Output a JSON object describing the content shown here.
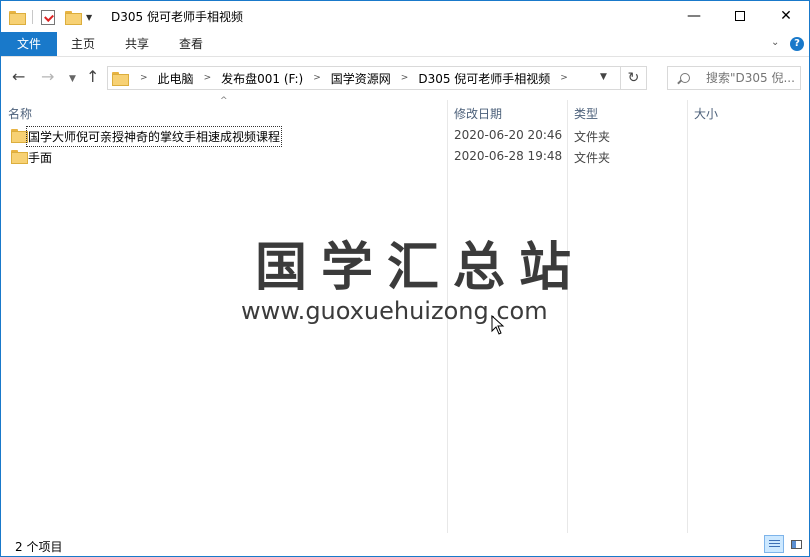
{
  "window": {
    "title": "D305 倪可老师手相视频",
    "accent_color": "#1979ca",
    "controls": {
      "minimize": "—",
      "maximize": "maximize",
      "close": "✕"
    }
  },
  "ribbon": {
    "tabs": [
      {
        "label": "文件",
        "active": true
      },
      {
        "label": "主页"
      },
      {
        "label": "共享"
      },
      {
        "label": "查看"
      }
    ],
    "help": "?"
  },
  "navigation": {
    "back": "←",
    "forward": "→",
    "recent": "⌄",
    "up": "↑",
    "breadcrumbs": [
      "此电脑",
      "发布盘001 (F:)",
      "国学资源网",
      "D305 倪可老师手相视频"
    ],
    "refresh": "↻",
    "search_placeholder": "搜索\"D305 倪..."
  },
  "columns": {
    "name": "名称",
    "date": "修改日期",
    "type": "类型",
    "size": "大小"
  },
  "files": [
    {
      "name": "国学大师倪可亲授神奇的掌纹手相速成视频课程",
      "date": "2020-06-20 20:46",
      "type": "文件夹",
      "size": "",
      "icon": "folder-icon"
    },
    {
      "name": "手面",
      "date": "2020-06-28 19:48",
      "type": "文件夹",
      "size": "",
      "icon": "folder-icon"
    }
  ],
  "watermark": {
    "title": "国学汇总站",
    "url": "www.guoxuehuizong.com"
  },
  "status": {
    "item_count": "2 个项目"
  }
}
